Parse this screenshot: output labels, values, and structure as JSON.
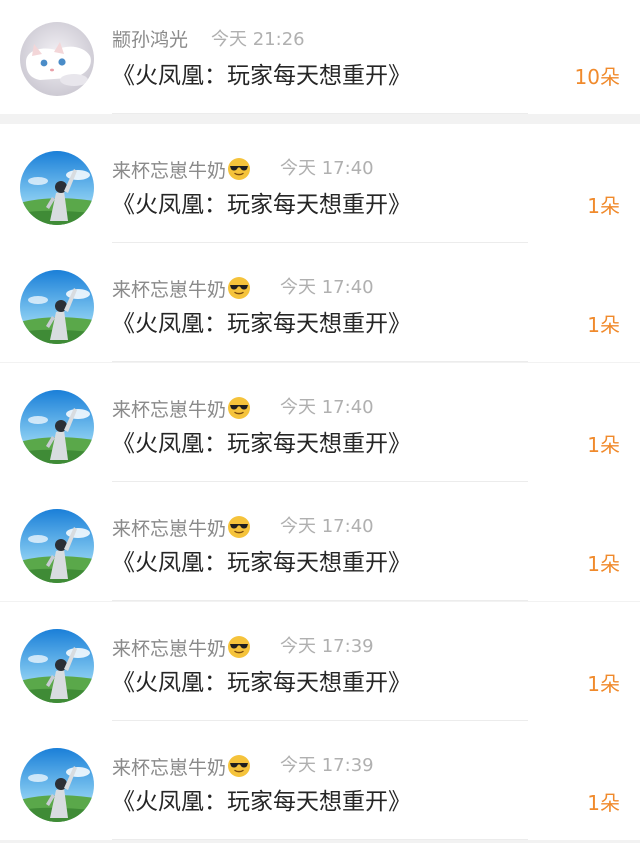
{
  "items": [
    {
      "username": "颛孙鸿光",
      "has_emoji": false,
      "time": "今天 21:26",
      "message": "《火凤凰：玩家每天想重开》",
      "count": "10朵",
      "avatar": "cat-avatar"
    },
    {
      "username": "来杯忘崽牛奶",
      "has_emoji": true,
      "time": "今天 17:40",
      "message": "《火凤凰：玩家每天想重开》",
      "count": "1朵",
      "avatar": "sky-avatar"
    },
    {
      "username": "来杯忘崽牛奶",
      "has_emoji": true,
      "time": "今天 17:40",
      "message": "《火凤凰：玩家每天想重开》",
      "count": "1朵",
      "avatar": "sky-avatar"
    },
    {
      "username": "来杯忘崽牛奶",
      "has_emoji": true,
      "time": "今天 17:40",
      "message": "《火凤凰：玩家每天想重开》",
      "count": "1朵",
      "avatar": "sky-avatar"
    },
    {
      "username": "来杯忘崽牛奶",
      "has_emoji": true,
      "time": "今天 17:40",
      "message": "《火凤凰：玩家每天想重开》",
      "count": "1朵",
      "avatar": "sky-avatar"
    },
    {
      "username": "来杯忘崽牛奶",
      "has_emoji": true,
      "time": "今天 17:39",
      "message": "《火凤凰：玩家每天想重开》",
      "count": "1朵",
      "avatar": "sky-avatar"
    },
    {
      "username": "来杯忘崽牛奶",
      "has_emoji": true,
      "time": "今天 17:39",
      "message": "《火凤凰：玩家每天想重开》",
      "count": "1朵",
      "avatar": "sky-avatar"
    }
  ],
  "icons": {
    "emoji": "sunglasses-emoji-icon"
  },
  "colors": {
    "count": "#f08a2c",
    "username": "#8a8a8a",
    "time": "#b0b0b0",
    "message": "#262626",
    "background": "#ffffff"
  }
}
